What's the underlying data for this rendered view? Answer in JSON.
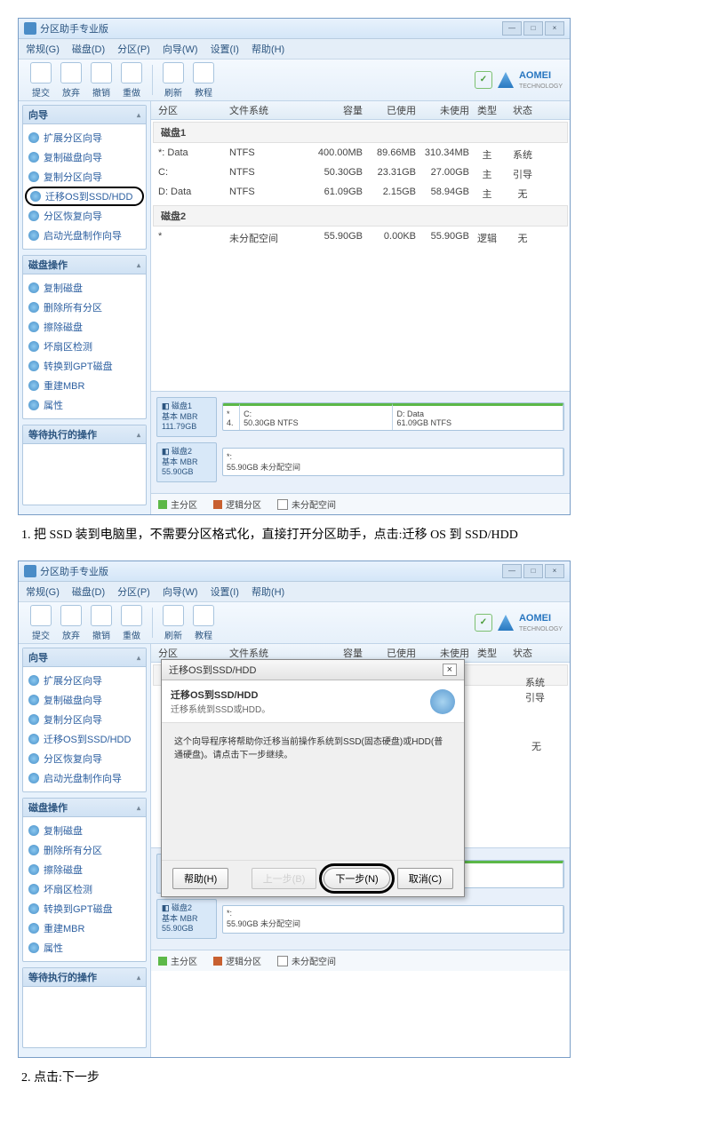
{
  "app": {
    "title": "分区助手专业版",
    "brand": "AOMEI",
    "brand_sub": "TECHNOLOGY"
  },
  "win": {
    "min": "—",
    "max": "□",
    "close": "×"
  },
  "menu": [
    "常规(G)",
    "磁盘(D)",
    "分区(P)",
    "向导(W)",
    "设置(I)",
    "帮助(H)"
  ],
  "toolbar": [
    {
      "label": "提交"
    },
    {
      "label": "放弃"
    },
    {
      "label": "撤销"
    },
    {
      "label": "重做"
    },
    {
      "label": "刷新"
    },
    {
      "label": "教程"
    }
  ],
  "sidebar": {
    "wizard_title": "向导",
    "wizard": [
      "扩展分区向导",
      "复制磁盘向导",
      "复制分区向导",
      "迁移OS到SSD/HDD",
      "分区恢复向导",
      "启动光盘制作向导"
    ],
    "diskops_title": "磁盘操作",
    "diskops": [
      "复制磁盘",
      "删除所有分区",
      "擦除磁盘",
      "坏扇区检测",
      "转换到GPT磁盘",
      "重建MBR",
      "属性"
    ],
    "pending_title": "等待执行的操作"
  },
  "table": {
    "cols": [
      "分区",
      "文件系统",
      "容量",
      "已使用",
      "未使用",
      "类型",
      "状态"
    ],
    "disk1": "磁盘1",
    "disk2": "磁盘2",
    "rows1": [
      {
        "p": "*: Data",
        "fs": "NTFS",
        "cap": "400.00MB",
        "used": "89.66MB",
        "free": "310.34MB",
        "type": "主",
        "stat": "系统"
      },
      {
        "p": "C:",
        "fs": "NTFS",
        "cap": "50.30GB",
        "used": "23.31GB",
        "free": "27.00GB",
        "type": "主",
        "stat": "引导"
      },
      {
        "p": "D: Data",
        "fs": "NTFS",
        "cap": "61.09GB",
        "used": "2.15GB",
        "free": "58.94GB",
        "type": "主",
        "stat": "无"
      }
    ],
    "rows2": [
      {
        "p": "*",
        "fs": "未分配空间",
        "cap": "55.90GB",
        "used": "0.00KB",
        "free": "55.90GB",
        "type": "逻辑",
        "stat": "无"
      }
    ]
  },
  "bars": {
    "d1": {
      "label": "磁盘1",
      "sub": "基本 MBR",
      "size": "111.79GB",
      "segs": [
        {
          "t": "*",
          "s": "4."
        },
        {
          "t": "C:",
          "s": "50.30GB NTFS"
        },
        {
          "t": "D: Data",
          "s": "61.09GB NTFS"
        }
      ]
    },
    "d2": {
      "label": "磁盘2",
      "sub": "基本 MBR",
      "size": "55.90GB",
      "segs": [
        {
          "t": "*:",
          "s": "55.90GB 未分配空间"
        }
      ]
    }
  },
  "legend": {
    "primary": "主分区",
    "logical": "逻辑分区",
    "unalloc": "未分配空间"
  },
  "instructions": {
    "step1": "1. 把 SSD 装到电脑里，不需要分区格式化，直接打开分区助手，点击:迁移 OS 到 SSD/HDD",
    "step2": "2. 点击:下一步"
  },
  "dialog": {
    "title": "迁移OS到SSD/HDD",
    "heading": "迁移OS到SSD/HDD",
    "sub": "迁移系统到SSD或HDD。",
    "body": "这个向导程序将帮助你迁移当前操作系统到SSD(固态硬盘)或HDD(普通硬盘)。请点击下一步继续。",
    "help": "帮助(H)",
    "prev": "上一步(B)",
    "next": "下一步(N)",
    "cancel": "取消(C)",
    "close": "×"
  }
}
